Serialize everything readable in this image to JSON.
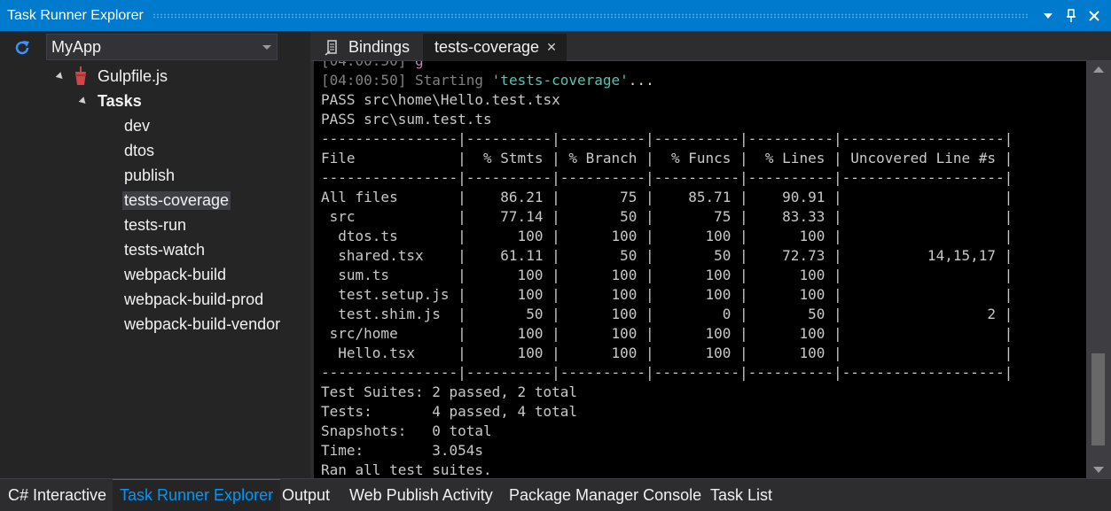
{
  "window": {
    "title": "Task Runner Explorer",
    "dropdown_icon": "dropdown-icon",
    "pin_icon": "pin-icon",
    "close_icon": "close-icon"
  },
  "toolbar": {
    "refresh_icon": "refresh-icon",
    "project": "MyApp"
  },
  "tree": {
    "file_label": "Gulpfile.js",
    "tasks_label": "Tasks",
    "tasks": [
      "dev",
      "dtos",
      "publish",
      "tests-coverage",
      "tests-run",
      "tests-watch",
      "webpack-build",
      "webpack-build-prod",
      "webpack-build-vendor"
    ],
    "selected_task": "tests-coverage"
  },
  "tabs": {
    "bindings": "Bindings",
    "active": "tests-coverage",
    "close_glyph": "✕"
  },
  "console": {
    "timestamp": "[04:00:50]",
    "starting_text": "Starting",
    "starting_task": "'tests-coverage'",
    "ellipsis": "...",
    "lines": [
      "PASS src\\home\\Hello.test.tsx",
      "PASS src\\sum.test.ts",
      "----------------|----------|----------|----------|----------|-------------------|",
      "File            |  % Stmts | % Branch |  % Funcs |  % Lines | Uncovered Line #s |",
      "----------------|----------|----------|----------|----------|-------------------|",
      "All files       |    86.21 |       75 |    85.71 |    90.91 |                   |",
      " src            |    77.14 |       50 |       75 |    83.33 |                   |",
      "  dtos.ts       |      100 |      100 |      100 |      100 |                   |",
      "  shared.tsx    |    61.11 |       50 |       50 |    72.73 |          14,15,17 |",
      "  sum.ts        |      100 |      100 |      100 |      100 |                   |",
      "  test.setup.js |      100 |      100 |      100 |      100 |                   |",
      "  test.shim.js  |       50 |      100 |        0 |       50 |                 2 |",
      " src/home       |      100 |      100 |      100 |      100 |                   |",
      "  Hello.tsx     |      100 |      100 |      100 |      100 |                   |",
      "----------------|----------|----------|----------|----------|-------------------|",
      "Test Suites: 2 passed, 2 total",
      "Tests:       4 passed, 4 total",
      "Snapshots:   0 total",
      "Time:        3.054s",
      "Ran all test suites."
    ]
  },
  "bottom_tabs": [
    "C# Interactive",
    "Task Runner Explorer",
    "Output",
    "Web Publish Activity",
    "Package Manager Console",
    "Task List"
  ],
  "active_bottom_tab": "Task Runner Explorer",
  "colors": {
    "accent": "#007acc",
    "console_bg": "#000000",
    "timestamp": "#808080",
    "task_name": "#4ec9b0"
  }
}
